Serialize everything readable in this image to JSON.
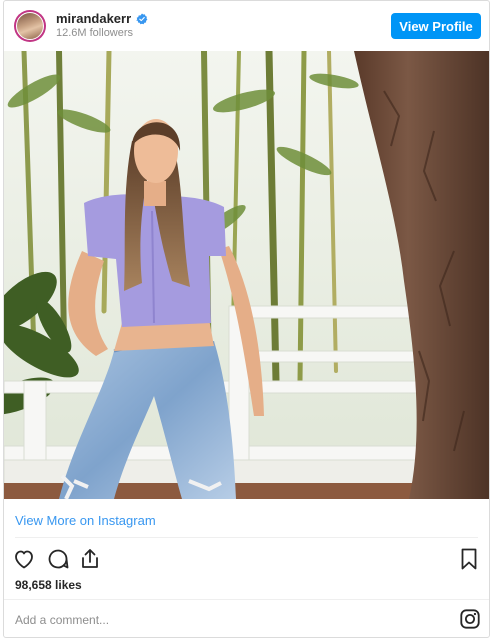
{
  "post": {
    "username": "mirandakerr",
    "followers": "12.6M followers",
    "view_profile_label": "View Profile",
    "view_more_label": "View More on Instagram",
    "likes": "98,658 likes",
    "comment_placeholder": "Add a comment..."
  },
  "colors": {
    "accent": "#0095f6",
    "link": "#3897f0",
    "verified": "#3897f0",
    "muted": "#8e8e8e",
    "text": "#262626"
  },
  "icons": {
    "verified": "verified-badge-icon",
    "like": "heart-icon",
    "comment": "comment-icon",
    "share": "share-icon",
    "save": "bookmark-icon",
    "instagram": "instagram-icon"
  }
}
